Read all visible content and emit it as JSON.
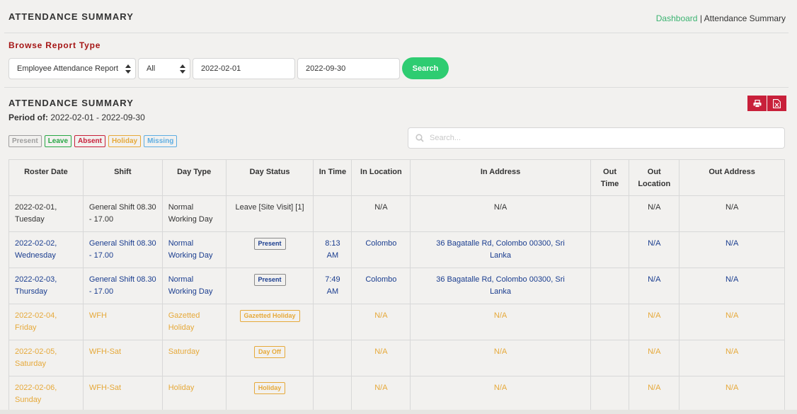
{
  "header": {
    "title": "ATTENDANCE SUMMARY",
    "breadcrumb": {
      "link": "Dashboard",
      "separator": " | ",
      "current": "Attendance Summary"
    }
  },
  "filters": {
    "section_label": "Browse Report Type",
    "report_type": "Employee Attendance Report",
    "scope": "All",
    "from_date": "2022-02-01",
    "to_date": "2022-09-30",
    "search_label": "Search"
  },
  "summary": {
    "title": "ATTENDANCE SUMMARY",
    "period_label": "Period of:",
    "period_value": "2022-02-01 - 2022-09-30",
    "print_icon": "print-icon",
    "excel_icon": "excel-file-icon"
  },
  "legend": [
    {
      "label": "Present",
      "color": "#9e9e9e"
    },
    {
      "label": "Leave",
      "color": "#28a745"
    },
    {
      "label": "Absent",
      "color": "#c8203a"
    },
    {
      "label": "Holiday",
      "color": "#e6a93a"
    },
    {
      "label": "Missing",
      "color": "#5dade2"
    }
  ],
  "table_search": {
    "placeholder": "Search..."
  },
  "table": {
    "columns": [
      "Roster Date",
      "Shift",
      "Day Type",
      "Day Status",
      "In Time",
      "In Location",
      "In Address",
      "Out Time",
      "Out Location",
      "Out Address"
    ],
    "rows": [
      {
        "roster_date": "2022-02-01, Tuesday",
        "shift": "General Shift 08.30 - 17.00",
        "day_type": "Normal Working Day",
        "day_status": "Leave [Site Visit] [1]",
        "status_is_badge": false,
        "in_time": "",
        "in_location": "N/A",
        "in_address": "N/A",
        "out_time": "",
        "out_location": "N/A",
        "out_address": "N/A",
        "style": "normal"
      },
      {
        "roster_date": "2022-02-02, Wednesday",
        "shift": "General Shift 08.30 - 17.00",
        "day_type": "Normal Working Day",
        "day_status": "Present",
        "status_is_badge": true,
        "in_time": "8:13 AM",
        "in_location": "Colombo",
        "in_address": "36 Bagatalle Rd, Colombo 00300, Sri Lanka",
        "out_time": "",
        "out_location": "N/A",
        "out_address": "N/A",
        "style": "present"
      },
      {
        "roster_date": "2022-02-03, Thursday",
        "shift": "General Shift 08.30 - 17.00",
        "day_type": "Normal Working Day",
        "day_status": "Present",
        "status_is_badge": true,
        "in_time": "7:49 AM",
        "in_location": "Colombo",
        "in_address": "36 Bagatalle Rd, Colombo 00300, Sri Lanka",
        "out_time": "",
        "out_location": "N/A",
        "out_address": "N/A",
        "style": "present"
      },
      {
        "roster_date": "2022-02-04, Friday",
        "shift": "WFH",
        "day_type": "Gazetted Holiday",
        "day_status": "Gazetted Holiday",
        "status_is_badge": true,
        "in_time": "",
        "in_location": "N/A",
        "in_address": "N/A",
        "out_time": "",
        "out_location": "N/A",
        "out_address": "N/A",
        "style": "holiday"
      },
      {
        "roster_date": "2022-02-05, Saturday",
        "shift": "WFH-Sat",
        "day_type": "Saturday",
        "day_status": "Day Off",
        "status_is_badge": true,
        "in_time": "",
        "in_location": "N/A",
        "in_address": "N/A",
        "out_time": "",
        "out_location": "N/A",
        "out_address": "N/A",
        "style": "holiday"
      },
      {
        "roster_date": "2022-02-06, Sunday",
        "shift": "WFH-Sat",
        "day_type": "Holiday",
        "day_status": "Holiday",
        "status_is_badge": true,
        "in_time": "",
        "in_location": "N/A",
        "in_address": "N/A",
        "out_time": "",
        "out_location": "N/A",
        "out_address": "N/A",
        "style": "holiday"
      }
    ]
  }
}
